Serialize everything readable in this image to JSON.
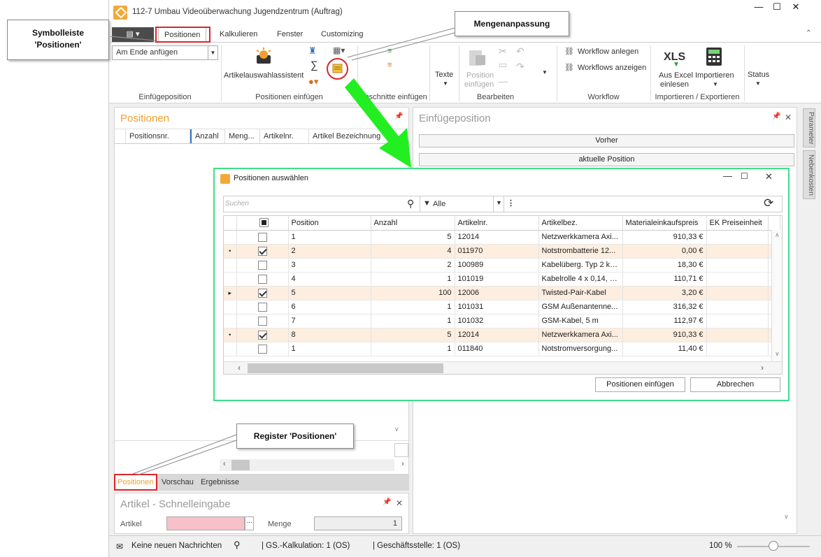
{
  "window": {
    "title": "112-7 Umbau Videoüberwachung Jugendzentrum (Auftrag)"
  },
  "ribbon_tabs": [
    "Positionen",
    "Kalkulieren",
    "Fenster",
    "Customizing"
  ],
  "ribbon": {
    "insert_mode": "Am Ende anfügen",
    "wizard_label": "Artikelauswahlassistent",
    "groups": {
      "einfuegeposition": "Einfügeposition",
      "positionen_einfuegen": "Positionen einfügen",
      "abschnitte": "Abschnitte einfügen",
      "bearbeiten": "Bearbeiten",
      "workflow": "Workflow",
      "import_export": "Importieren / Exportieren"
    },
    "texte": "Texte",
    "position_einfuegen_1": "Position",
    "position_einfuegen_2": "einfügen",
    "workflow_anlegen": "Workflow anlegen",
    "workflows_anzeigen": "Workflows anzeigen",
    "xls": "XLS",
    "aus_excel_1": "Aus Excel",
    "aus_excel_2": "einlesen",
    "importieren": "Importieren",
    "status": "Status"
  },
  "left_panel": {
    "title": "Positionen",
    "columns": [
      "Positionsnr.",
      "Anzahl",
      "Meng...",
      "Artikelnr.",
      "Artikel Bezeichnung"
    ],
    "tabs": [
      "Positionen",
      "Vorschau",
      "Ergebnisse"
    ]
  },
  "right_panel": {
    "title": "Einfügeposition",
    "btn_vorher": "Vorher",
    "btn_aktuell": "aktuelle Position"
  },
  "side_tabs": [
    "Parameter",
    "Nebenkosten"
  ],
  "quick_entry": {
    "title": "Artikel - Schnelleingabe",
    "artikel_label": "Artikel",
    "menge_label": "Menge",
    "menge_value": "1"
  },
  "dialog": {
    "title": "Positionen auswählen",
    "search_placeholder": "Suchen",
    "filter_value": "Alle",
    "columns": [
      "Position",
      "Anzahl",
      "Artikelnr.",
      "Artikelbez.",
      "Materialeinkaufspreis",
      "EK Preiseinheit"
    ],
    "rows": [
      {
        "mark": "",
        "checked": false,
        "pos": "1",
        "anzahl": "5",
        "nr": "12014",
        "bez": "Netzwerkkamera Axi...",
        "preis": "910,33 €",
        "sel": false
      },
      {
        "mark": "•",
        "checked": true,
        "pos": "2",
        "anzahl": "4",
        "nr": "011970",
        "bez": "Notstrombatterie 12...",
        "preis": "0,00 €",
        "sel": true
      },
      {
        "mark": "",
        "checked": false,
        "pos": "3",
        "anzahl": "2",
        "nr": "100989",
        "bez": "Kabelüberg. Typ 2 ko...",
        "preis": "18,30 €",
        "sel": false
      },
      {
        "mark": "",
        "checked": false,
        "pos": "4",
        "anzahl": "1",
        "nr": "101019",
        "bez": "Kabelrolle 4 x 0,14, b...",
        "preis": "110,71 €",
        "sel": false
      },
      {
        "mark": "▸",
        "checked": true,
        "pos": "5",
        "anzahl": "100",
        "nr": "12006",
        "bez": "Twisted-Pair-Kabel",
        "preis": "3,20 €",
        "sel": true
      },
      {
        "mark": "",
        "checked": false,
        "pos": "6",
        "anzahl": "1",
        "nr": "101031",
        "bez": "GSM Außenantenne...",
        "preis": "316,32 €",
        "sel": false
      },
      {
        "mark": "",
        "checked": false,
        "pos": "7",
        "anzahl": "1",
        "nr": "101032",
        "bez": "GSM-Kabel, 5 m",
        "preis": "112,97 €",
        "sel": false
      },
      {
        "mark": "•",
        "checked": true,
        "pos": "8",
        "anzahl": "5",
        "nr": "12014",
        "bez": "Netzwerkkamera Axi...",
        "preis": "910,33 €",
        "sel": true
      },
      {
        "mark": "",
        "checked": false,
        "pos": "1",
        "anzahl": "1",
        "nr": "011840",
        "bez": "Notstromversorgung...",
        "preis": "11,40 €",
        "sel": false
      }
    ],
    "btn_insert": "Positionen einfügen",
    "btn_cancel": "Abbrechen"
  },
  "callouts": {
    "symbolleiste_1": "Symbolleiste",
    "symbolleiste_2": "'Positionen'",
    "mengenanpassung": "Mengenanpassung",
    "register": "Register 'Positionen'"
  },
  "statusbar": {
    "messages": "Keine neuen Nachrichten",
    "kalkulation": "| GS.-Kalkulation:  1 (OS)",
    "geschaeftsstelle": "| Geschäftsstelle:  1 (OS)",
    "zoom": "100 %"
  },
  "colors": {
    "accent_orange": "#f0a030",
    "highlight_red": "#d9262c",
    "dialog_border": "#3ddf8a",
    "arrow_green": "#22ee22",
    "selected_row": "#fdeee0"
  }
}
